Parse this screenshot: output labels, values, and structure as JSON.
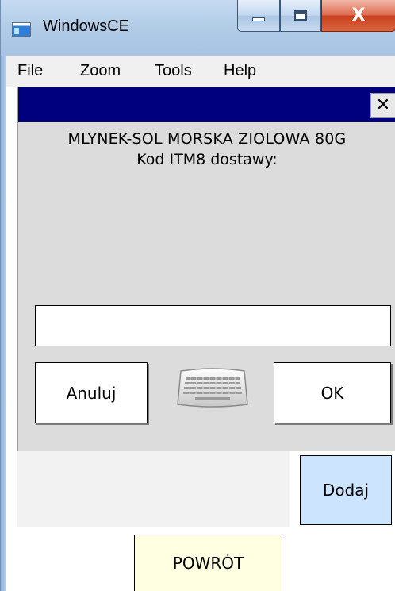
{
  "window": {
    "title": "WindowsCE",
    "minimize_glyph": "",
    "maximize_glyph": "",
    "close_glyph": "X"
  },
  "menu": {
    "items": [
      "File",
      "Zoom",
      "Tools",
      "Help"
    ]
  },
  "dialog": {
    "close_glyph": "✕",
    "product_name": "MLYNEK-SOL MORSKA ZIOLOWA 80G",
    "prompt": "Kod ITM8 dostawy:",
    "input_value": "",
    "cancel_label": "Anuluj",
    "ok_label": "OK",
    "keyboard_icon": "keyboard-icon"
  },
  "actions": {
    "add_label": "Dodaj",
    "back_label": "POWRÓT"
  },
  "colors": {
    "dialog_caption": "#00007f",
    "dialog_body": "#dcdcdc",
    "add_button": "#cde4ff",
    "back_button": "#ffffe1"
  }
}
